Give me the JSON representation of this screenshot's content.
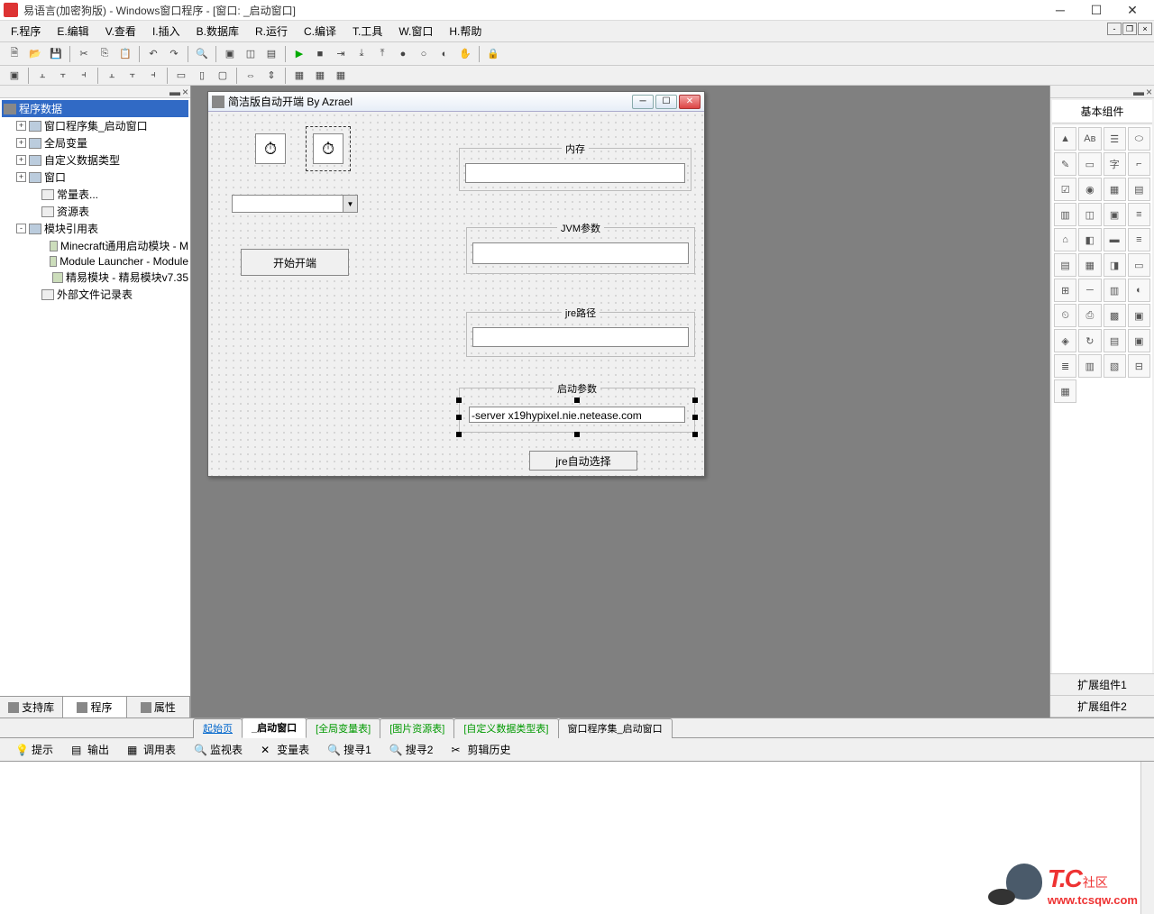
{
  "titlebar": {
    "title": "易语言(加密狗版) - Windows窗口程序 - [窗口: _启动窗口]"
  },
  "menu": {
    "items": [
      "F.程序",
      "E.编辑",
      "V.查看",
      "I.插入",
      "B.数据库",
      "R.运行",
      "C.编译",
      "T.工具",
      "W.窗口",
      "H.帮助"
    ]
  },
  "tree": {
    "root": "程序数据",
    "nodes": [
      {
        "exp": "+",
        "label": "窗口程序集_启动窗口",
        "icon": "form"
      },
      {
        "exp": "+",
        "label": "全局变量",
        "icon": "form"
      },
      {
        "exp": "+",
        "label": "自定义数据类型",
        "icon": "form"
      },
      {
        "exp": "+",
        "label": "窗口",
        "icon": "form"
      },
      {
        "exp": "",
        "label": "常量表...",
        "icon": "doc",
        "indent": 1
      },
      {
        "exp": "",
        "label": "资源表",
        "icon": "doc",
        "indent": 1
      },
      {
        "exp": "-",
        "label": "模块引用表",
        "icon": "form"
      },
      {
        "exp": "",
        "label": "Minecraft通用启动模块 - M",
        "icon": "mod",
        "indent": 2
      },
      {
        "exp": "",
        "label": "Module Launcher - Module",
        "icon": "mod",
        "indent": 2
      },
      {
        "exp": "",
        "label": "精易模块 - 精易模块v7.35",
        "icon": "mod",
        "indent": 2
      },
      {
        "exp": "",
        "label": "外部文件记录表",
        "icon": "doc",
        "indent": 1
      }
    ]
  },
  "left_tabs": {
    "t1": "支持库",
    "t2": "程序",
    "t3": "属性"
  },
  "form": {
    "title": "简洁版自动开端 By Azrael",
    "start_button": "开始开端",
    "group_mem": "内存",
    "group_jvm": "JVM参数",
    "group_jre": "jre路径",
    "group_launch": "启动参数",
    "launch_value": "-server x19hypixel.nie.netease.com",
    "jre_button": "jre自动选择"
  },
  "center_tabs": {
    "t0": "起始页",
    "t1": "_启动窗口",
    "t2": "[全局变量表]",
    "t3": "[图片资源表]",
    "t4": "[自定义数据类型表]",
    "t5": "窗口程序集_启动窗口"
  },
  "right": {
    "title": "基本组件",
    "foot1": "扩展组件1",
    "foot2": "扩展组件2"
  },
  "palette_icons": [
    "▲",
    "Aв",
    "☰",
    "⬭",
    "✎",
    "▭",
    "字",
    "⌐",
    "☑",
    "◉",
    "▦",
    "▤",
    "▥",
    "◫",
    "▣",
    "≡",
    "⌂",
    "◧",
    "▬",
    "≡",
    "▤",
    "▦",
    "◨",
    "▭",
    "⊞",
    "─",
    "▥",
    "◐",
    "⏲",
    "⎙",
    "▩",
    "▣",
    "◈",
    "↻",
    "▤",
    "▣",
    "≣",
    "▥",
    "▧",
    "⊟",
    "▦"
  ],
  "bottom_tabs": {
    "t1": "提示",
    "t2": "输出",
    "t3": "调用表",
    "t4": "监视表",
    "t5": "变量表",
    "t6": "搜寻1",
    "t7": "搜寻2",
    "t8": "剪辑历史"
  },
  "watermark": {
    "tc": "T.C",
    "cn": "社区",
    "url": "www.tcsqw.com"
  }
}
